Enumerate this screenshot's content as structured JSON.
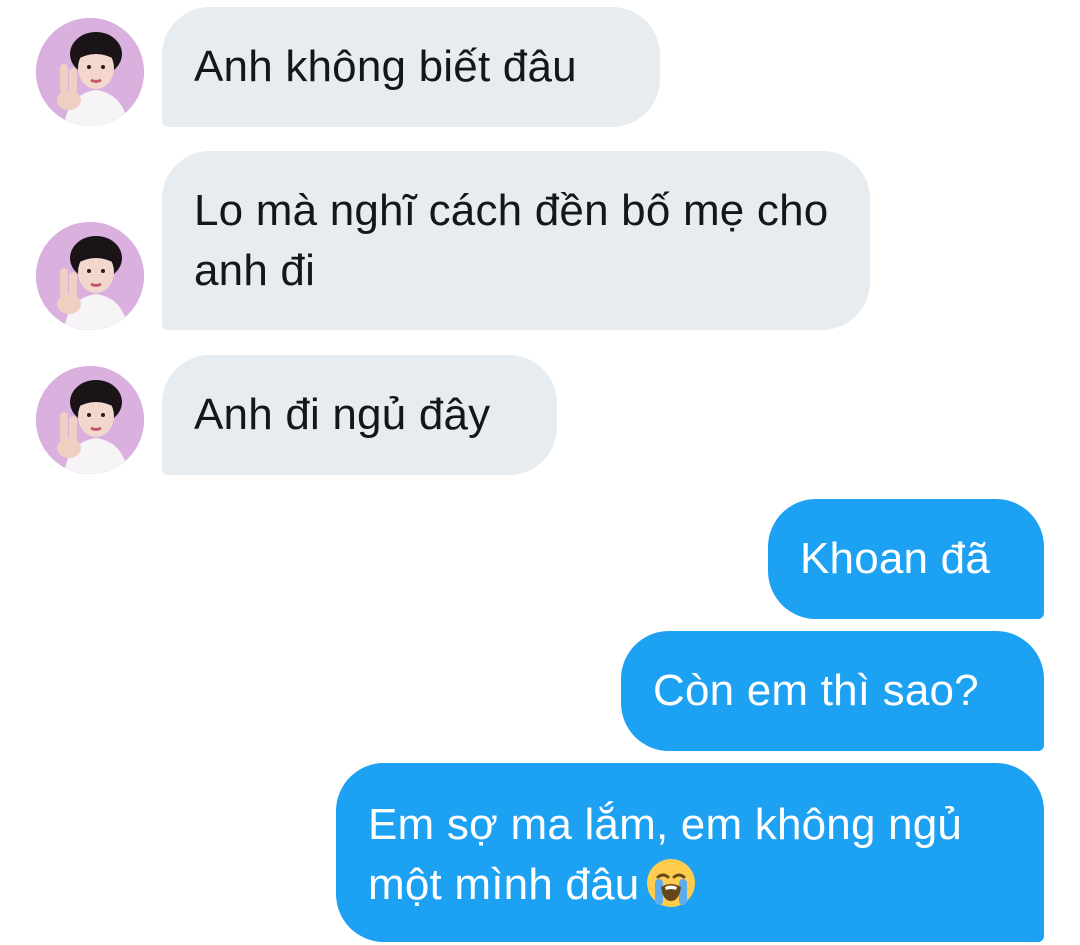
{
  "conversation": {
    "messages": [
      {
        "sender": "other",
        "text": "Anh không biết đâu",
        "avatar": "profile-avatar"
      },
      {
        "sender": "other",
        "text": "Lo mà nghĩ cách đền bố mẹ cho anh đi",
        "avatar": "profile-avatar"
      },
      {
        "sender": "other",
        "text": "Anh đi ngủ đây",
        "avatar": "profile-avatar"
      },
      {
        "sender": "self",
        "text": "Khoan đã"
      },
      {
        "sender": "self",
        "text": "Còn em thì sao?"
      },
      {
        "sender": "self",
        "text": "Em sợ ma lắm, em không ngủ một mình đâu",
        "emoji": "loudly-crying-face-icon"
      }
    ]
  },
  "colors": {
    "incoming_bubble": "#e6ecf0",
    "outgoing_bubble": "#1da1f2",
    "incoming_text": "#14171a",
    "outgoing_text": "#ffffff"
  }
}
